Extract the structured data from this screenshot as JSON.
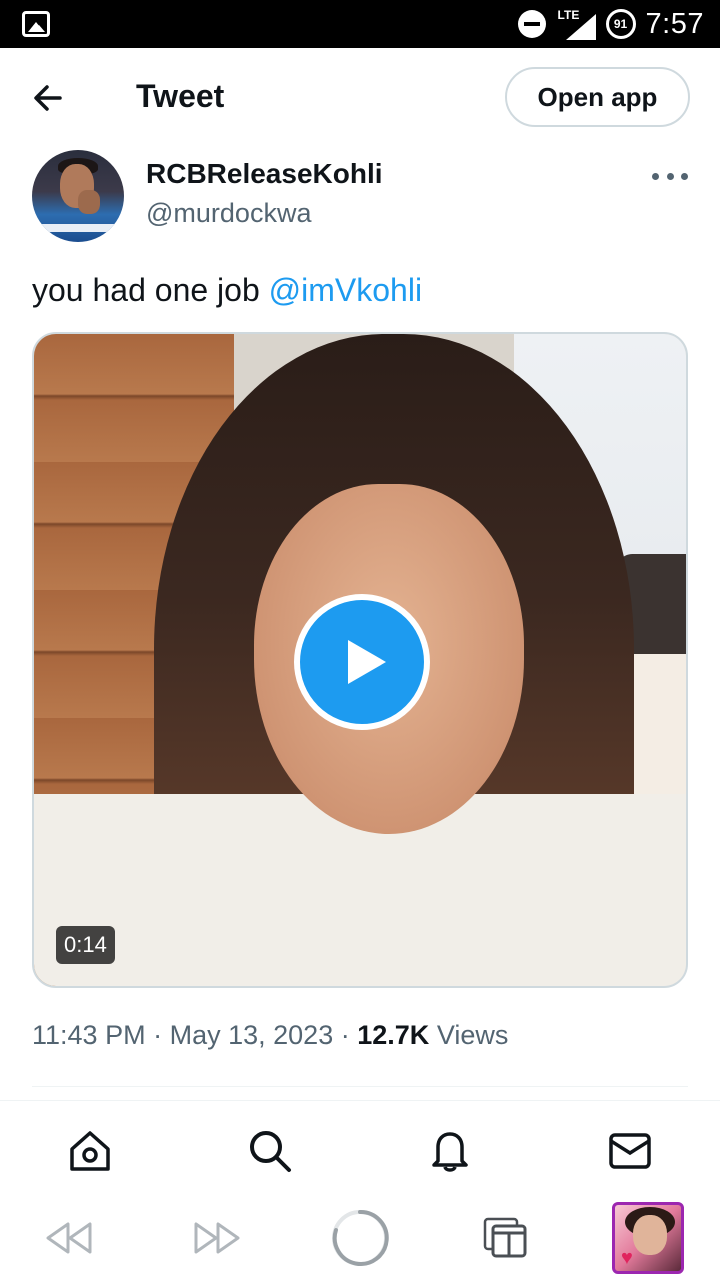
{
  "status_bar": {
    "network": "LTE",
    "battery": "91",
    "time": "7:57"
  },
  "header": {
    "title": "Tweet",
    "open_app_label": "Open app"
  },
  "tweet": {
    "author": {
      "display_name": "RCBReleaseKohli",
      "handle": "@murdockwa"
    },
    "text": "you had one job ",
    "mention": "@imVkohli",
    "media": {
      "type": "video",
      "duration": "0:14"
    },
    "time": "11:43 PM",
    "separator": "·",
    "date": "May 13, 2023",
    "views_count": "12.7K",
    "views_label": "Views"
  },
  "tabbar": {
    "items": [
      "home-icon",
      "search-icon",
      "notifications-icon",
      "messages-icon"
    ]
  },
  "browser_bar": {
    "items": [
      "rewind-icon",
      "fast-forward-icon",
      "loading-spinner-icon",
      "tabs-icon",
      "page-thumbnail"
    ]
  },
  "colors": {
    "accent": "#1d9bf0",
    "text_primary": "#0f1419",
    "text_secondary": "#536471",
    "border": "#cfd9de",
    "thumbnail_border": "#9c27b0"
  }
}
